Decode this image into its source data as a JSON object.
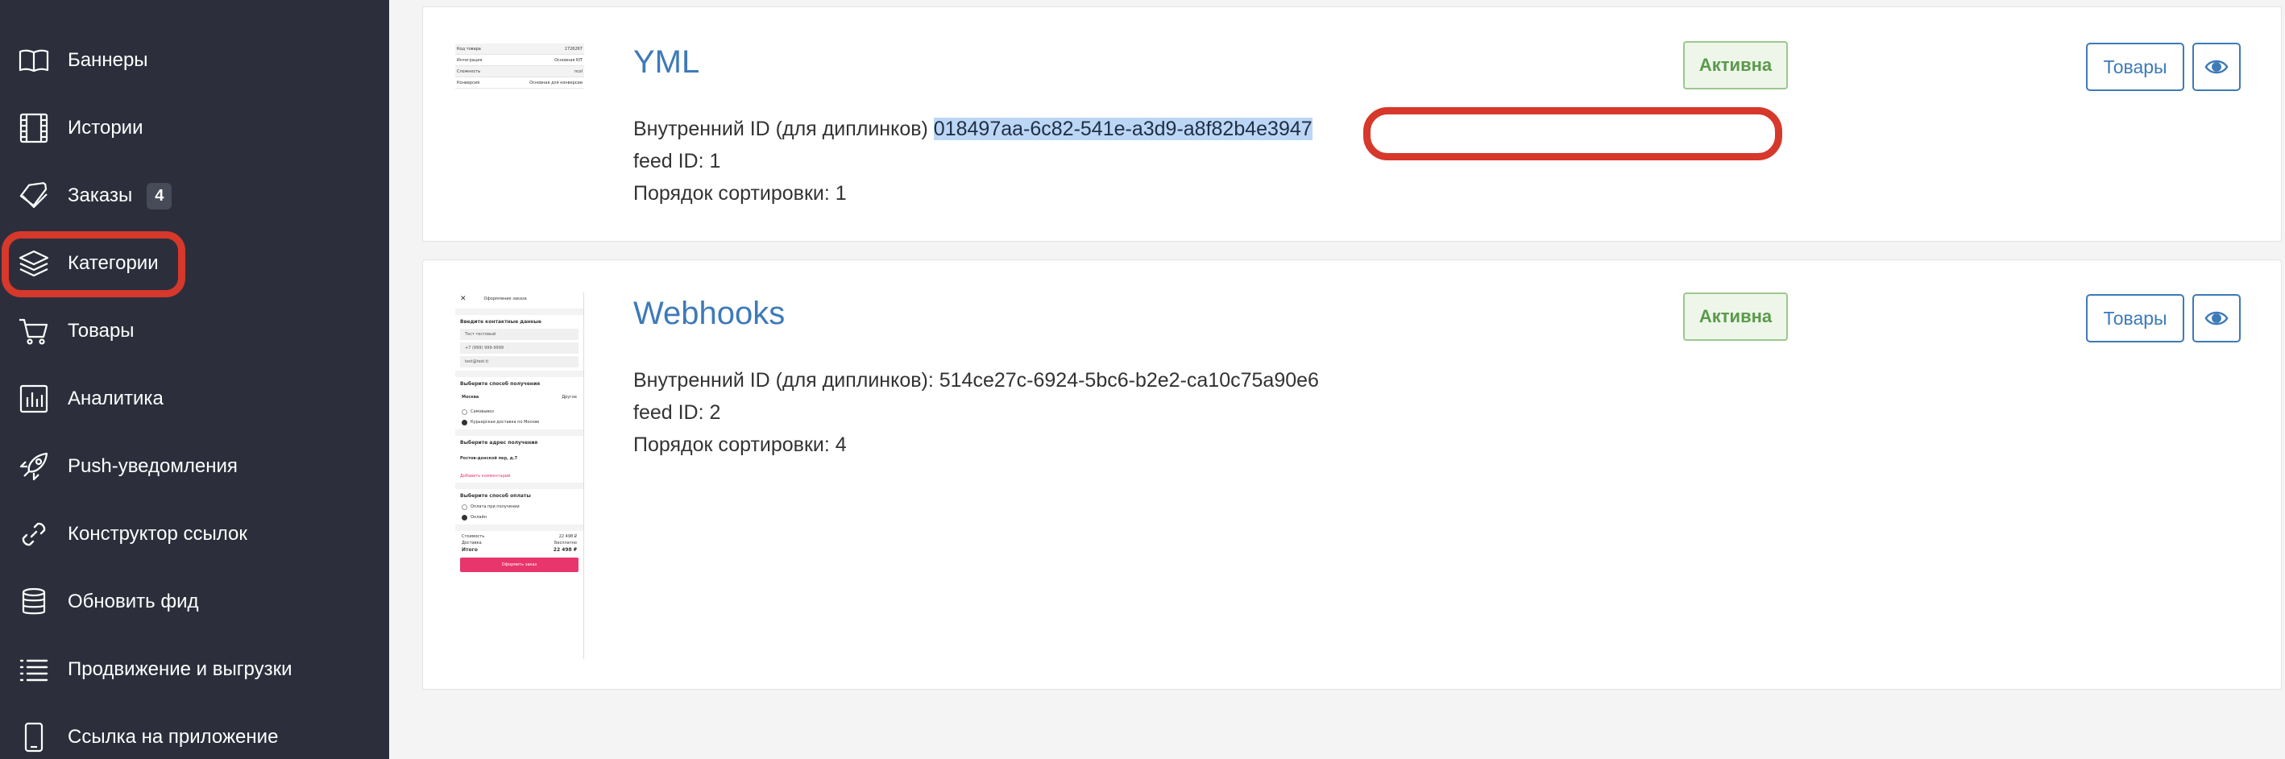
{
  "sidebar": {
    "items": [
      {
        "label": "Баннеры",
        "icon": "book-open-icon"
      },
      {
        "label": "Истории",
        "icon": "film-icon"
      },
      {
        "label": "Заказы",
        "icon": "tag-icon",
        "badge": "4"
      },
      {
        "label": "Категории",
        "icon": "layers-icon"
      },
      {
        "label": "Товары",
        "icon": "shopping-cart-icon"
      },
      {
        "label": "Аналитика",
        "icon": "bar-chart-icon"
      },
      {
        "label": "Push-уведомления",
        "icon": "rocket-icon"
      },
      {
        "label": "Конструктор ссылок",
        "icon": "link-icon"
      },
      {
        "label": "Обновить фид",
        "icon": "database-icon"
      },
      {
        "label": "Продвижение и выгрузки",
        "icon": "list-icon"
      },
      {
        "label": "Ссылка на приложение",
        "icon": "smartphone-icon"
      }
    ],
    "highlighted_item": "Категории"
  },
  "colors": {
    "sidebar_bg": "#2c2f3b",
    "accent_blue": "#3d7ab8",
    "status_green": "#5a9a4a",
    "annotation_red": "#d6382b",
    "selection_blue": "#bcd6f5"
  },
  "feeds": [
    {
      "title": "YML",
      "id_label": "Внутренний ID (для диплинков)",
      "id_value": "018497aa-6c82-541e-a3d9-a8f82b4e3947",
      "feed_id_line": "feed ID: 1",
      "sort_line": "Порядок сортировки: 1",
      "status": "Активна",
      "goods_button": "Товары",
      "thumbnail": {
        "rows": [
          [
            "Код товара",
            "1726267"
          ],
          [
            "Интеграция",
            "Основная RIT"
          ],
          [
            "Сложность",
            "ncsl"
          ],
          [
            "Конверсия",
            "Основная для конверсии"
          ]
        ]
      }
    },
    {
      "title": "Webhooks",
      "id_label": "Внутренний ID (для диплинков):",
      "id_value": "514ce27c-6924-5bc6-b2e2-ca10c75a90e6",
      "feed_id_line": "feed ID: 2",
      "sort_line": "Порядок сортировки: 4",
      "status": "Активна",
      "goods_button": "Товары",
      "thumbnail": {
        "header": "Оформление заказа",
        "contacts_title": "Введите контактные данные",
        "fields": [
          "Тест тестовый",
          "+7 (999) 999-9999",
          "test@test.ti"
        ],
        "delivery_title": "Выберите способ получения",
        "city_label": "Москва",
        "city_value": "Другое",
        "delivery_options": [
          "Самовывоз",
          "Курьерская доставка по Москве"
        ],
        "address_title": "Выберите адрес получения",
        "address_value": "Ростов-донской пер, д.7",
        "comment_link": "Добавить комментарий",
        "payment_title": "Выберите способ оплаты",
        "payment_options": [
          "Оплата при получении",
          "Онлайн"
        ],
        "totals": [
          [
            "Стоимость",
            "22 498 ₽"
          ],
          [
            "Доставка",
            "Бесплатно"
          ],
          [
            "Итого",
            "22 498 ₽"
          ]
        ],
        "submit_label": "Оформить заказ"
      }
    }
  ]
}
